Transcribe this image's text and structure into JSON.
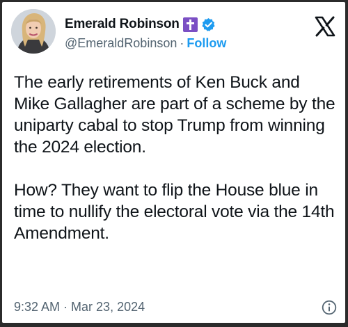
{
  "author": {
    "display_name": "Emerald Robinson",
    "handle": "@EmeraldRobinson",
    "separator": "·",
    "follow_label": "Follow"
  },
  "icons": {
    "avatar": "profile-photo",
    "badge_1": "latin-cross-badge",
    "badge_2": "verified-checkmark",
    "logo": "x-logo",
    "info": "info-icon"
  },
  "colors": {
    "badge_purple": "#7b4fc4",
    "verified_blue": "#1d9bf0",
    "follow_blue": "#1d9bf0",
    "text": "#0f1419",
    "secondary_text": "#536471"
  },
  "post": {
    "paragraphs": [
      "The early retirements of Ken Buck and Mike Gallagher are part of a scheme by the uniparty cabal to stop Trump from winning the 2024 election.",
      "How? They want to flip the House blue in time to nullify the electoral vote via the 14th Amendment."
    ]
  },
  "meta": {
    "time": "9:32 AM",
    "separator": "·",
    "date": "Mar 23, 2024"
  }
}
